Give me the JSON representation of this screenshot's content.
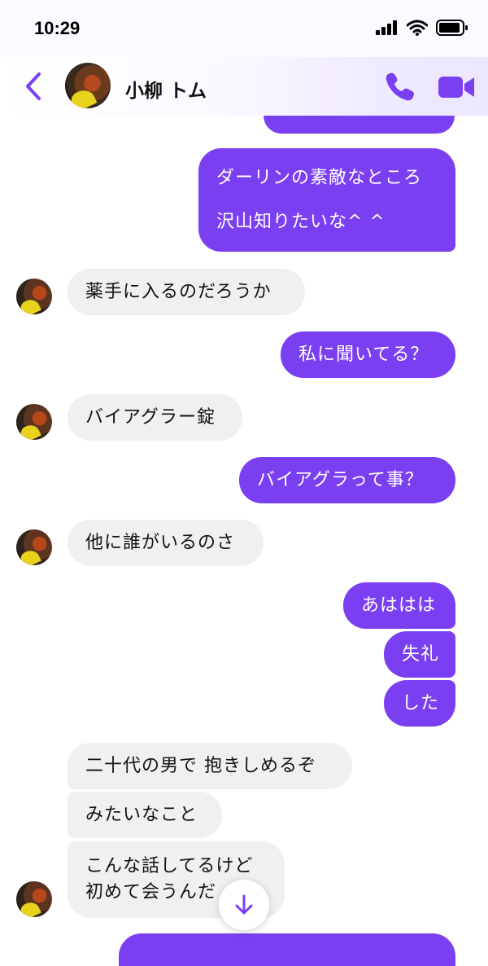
{
  "status_bar": {
    "time": "10:29"
  },
  "header": {
    "contact_name": "小柳 トム"
  },
  "messages": [
    {
      "direction": "out",
      "lines": [
        "ダーリンの素敵なところ",
        "沢山知りたいな^ ^"
      ]
    },
    {
      "direction": "in",
      "lines": [
        "薬手に入るのだろうか"
      ]
    },
    {
      "direction": "out",
      "lines": [
        "私に聞いてる？"
      ]
    },
    {
      "direction": "in",
      "lines": [
        "バイアグラー錠"
      ]
    },
    {
      "direction": "out",
      "lines": [
        "バイアグラって事？"
      ]
    },
    {
      "direction": "in",
      "lines": [
        "他に誰がいるのさ"
      ]
    },
    {
      "direction": "out",
      "lines": [
        "あははは"
      ]
    },
    {
      "direction": "out",
      "lines": [
        "失礼"
      ]
    },
    {
      "direction": "out",
      "lines": [
        "した"
      ]
    },
    {
      "direction": "in",
      "lines": [
        "二十代の男で 抱きしめるぞ"
      ]
    },
    {
      "direction": "in",
      "lines": [
        "みたいなこと"
      ]
    },
    {
      "direction": "in",
      "lines": [
        "こんな話してるけど",
        "初めて会うんだ"
      ]
    }
  ],
  "colors": {
    "accent": "#7b3ff2",
    "incoming_bubble": "#f0f0f2"
  },
  "icons": {
    "back": "chevron-left-icon",
    "call": "phone-icon",
    "video": "video-camera-icon",
    "scroll": "arrow-down-icon"
  }
}
